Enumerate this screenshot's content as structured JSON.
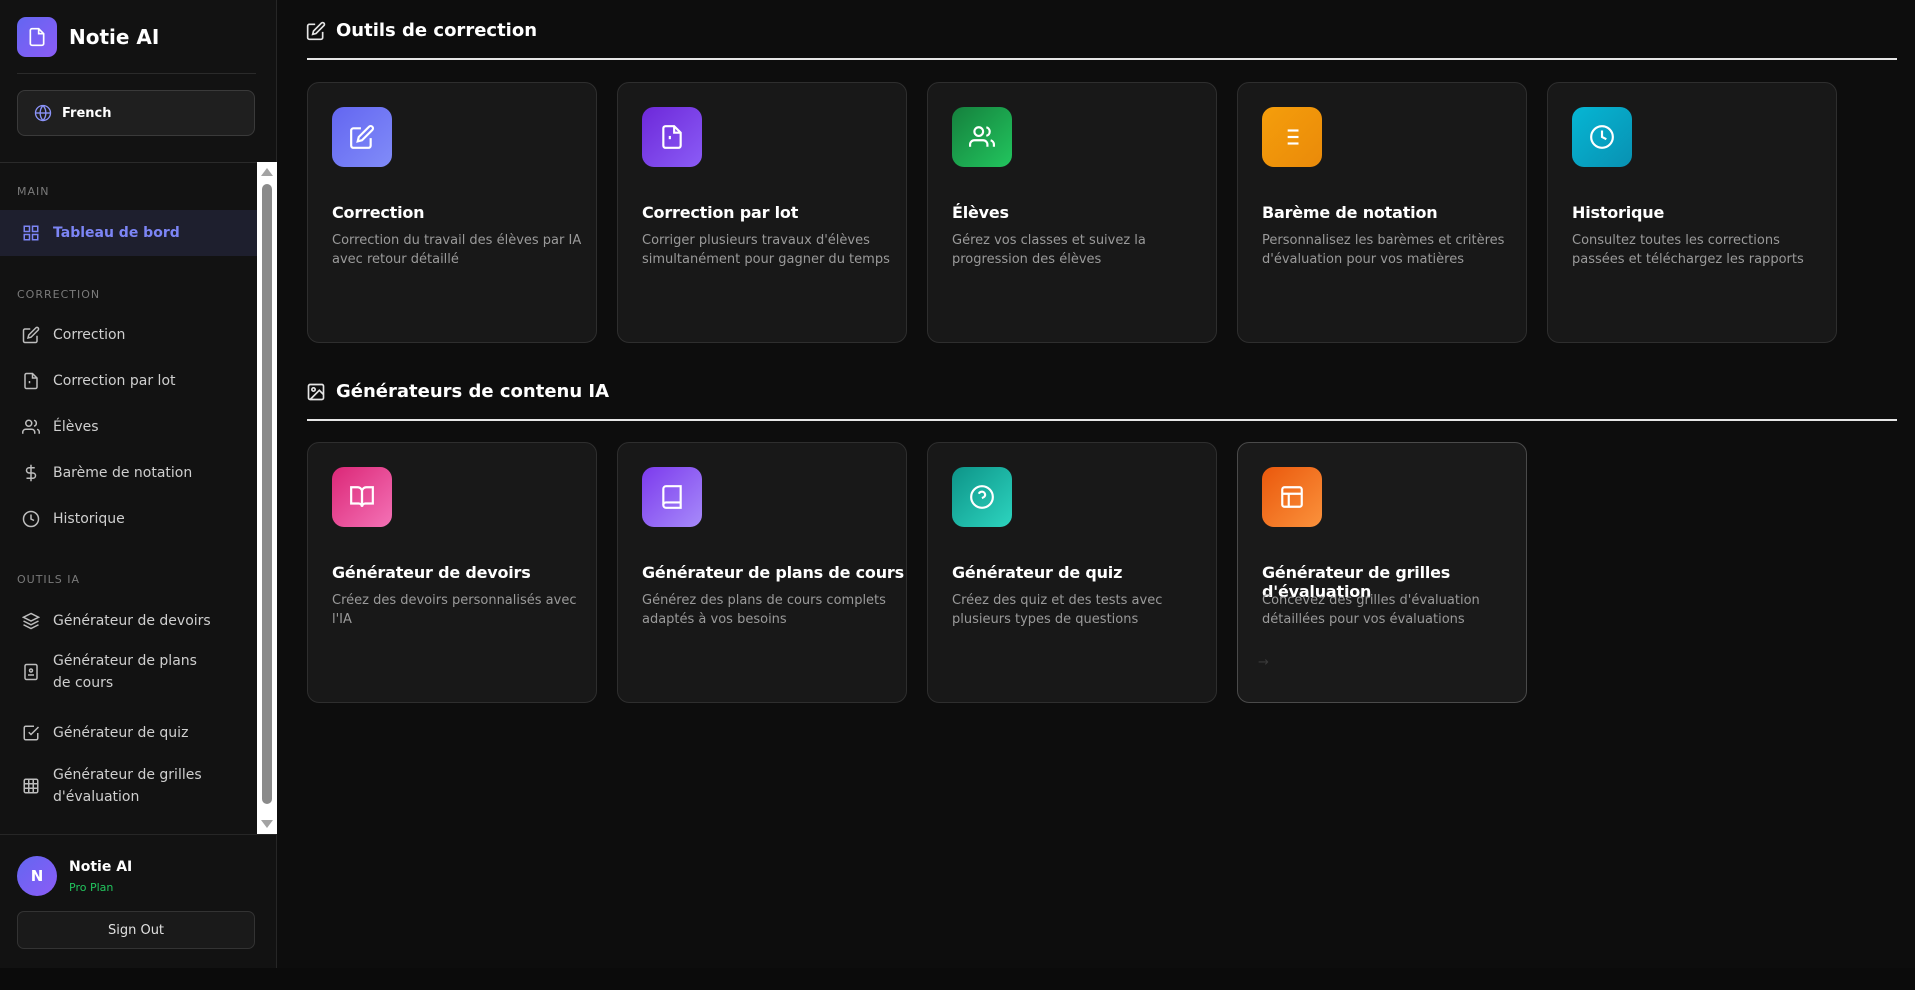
{
  "brand": {
    "name": "Notie AI"
  },
  "language": {
    "label": "French"
  },
  "nav": {
    "sections": {
      "main": "MAIN",
      "correction": "CORRECTION",
      "tools": "OUTILS IA"
    },
    "items": {
      "dashboard": "Tableau de bord",
      "correction": "Correction",
      "batch": "Correction par lot",
      "students": "Élèves",
      "grading": "Barème de notation",
      "history": "Historique",
      "homework": "Générateur de devoirs",
      "lessons": "Générateur de plans de cours",
      "quiz": "Générateur de quiz",
      "rubrics": "Générateur de grilles d'évaluation"
    }
  },
  "user": {
    "initial": "N",
    "name": "Notie AI",
    "plan": "Pro Plan",
    "signout": "Sign Out"
  },
  "sections": {
    "tools_title": "Outils de correction",
    "gen_title": "Générateurs de contenu IA"
  },
  "tool_cards": [
    {
      "title": "Correction",
      "desc": "Correction du travail des élèves par IA avec retour détaillé",
      "color": "#6366f1"
    },
    {
      "title": "Correction par lot",
      "desc": "Corriger plusieurs travaux d'élèves simultanément pour gagner du temps",
      "color": "#7c3aed"
    },
    {
      "title": "Élèves",
      "desc": "Gérez vos classes et suivez la progression des élèves",
      "color": "#16a34a"
    },
    {
      "title": "Barème de notation",
      "desc": "Personnalisez les barèmes et critères d'évaluation pour vos matières",
      "color": "#f59e0b"
    },
    {
      "title": "Historique",
      "desc": "Consultez toutes les corrections passées et téléchargez les rapports",
      "color": "#0ea5c6"
    }
  ],
  "gen_cards": [
    {
      "title": "Générateur de devoirs",
      "desc": "Créez des devoirs personnalisés avec l'IA",
      "color": "#ec4899"
    },
    {
      "title": "Générateur de plans de cours",
      "desc": "Générez des plans de cours complets adaptés à vos besoins",
      "color": "#8b5cf6"
    },
    {
      "title": "Générateur de quiz",
      "desc": "Créez des quiz et des tests avec plusieurs types de questions",
      "color": "#14b8a6"
    },
    {
      "title": "Générateur de grilles d'évaluation",
      "desc": "Concevez des grilles d'évaluation détaillées pour vos évaluations",
      "color": "#f97316",
      "arrow": "→"
    }
  ]
}
